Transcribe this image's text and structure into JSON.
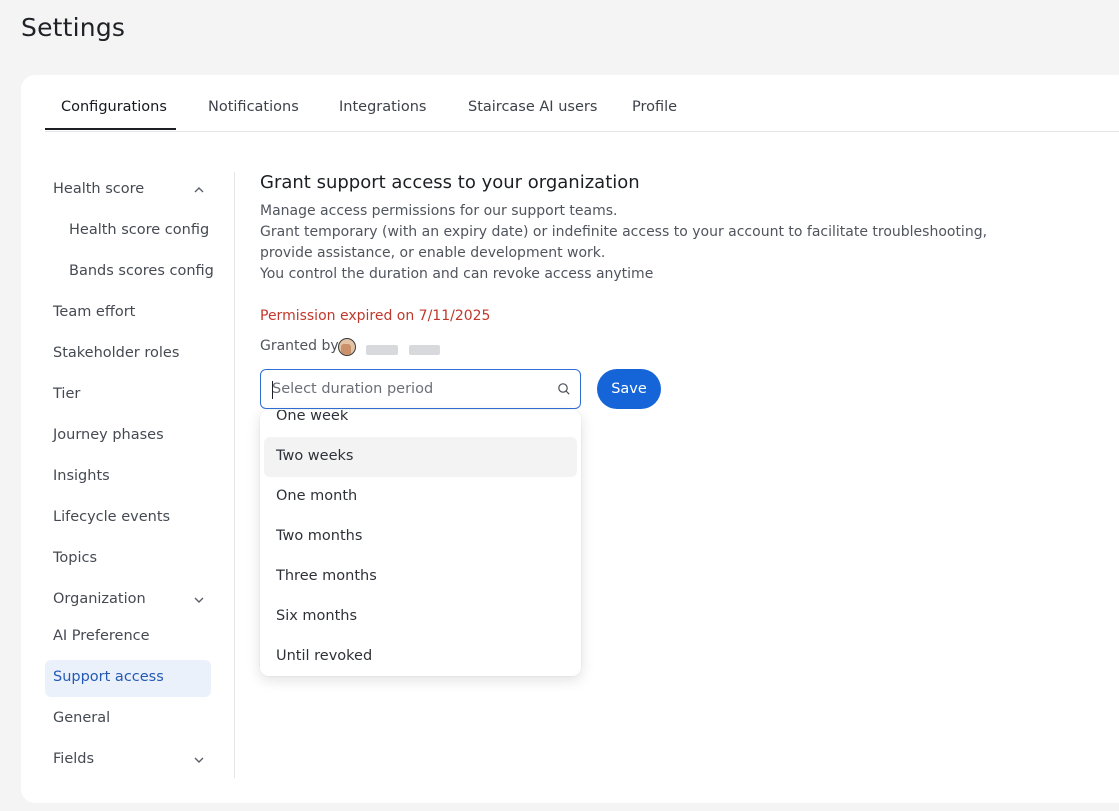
{
  "page": {
    "title": "Settings"
  },
  "tabs": [
    {
      "label": "Configurations",
      "active": true
    },
    {
      "label": "Notifications"
    },
    {
      "label": "Integrations"
    },
    {
      "label": "Staircase AI users"
    },
    {
      "label": "Profile"
    }
  ],
  "sidebar": {
    "items": [
      {
        "label": "Health score",
        "expanded": true
      },
      {
        "label": "Health score config"
      },
      {
        "label": "Bands scores config"
      },
      {
        "label": "Team effort"
      },
      {
        "label": "Stakeholder roles"
      },
      {
        "label": "Tier"
      },
      {
        "label": "Journey phases"
      },
      {
        "label": "Insights"
      },
      {
        "label": "Lifecycle events"
      },
      {
        "label": "Topics"
      },
      {
        "label": "Organization",
        "expanded": false
      },
      {
        "label": "AI Preference"
      },
      {
        "label": "Support access",
        "active": true
      },
      {
        "label": "General"
      },
      {
        "label": "Fields",
        "expanded": false
      }
    ]
  },
  "support": {
    "title": "Grant support access to your organization",
    "desc1": "Manage access permissions for our support teams.",
    "desc2": "Grant temporary (with an expiry date) or indefinite access to your account to facilitate troubleshooting, provide assistance, or enable development work.",
    "desc3": "You control the duration and can revoke access anytime",
    "expired": "Permission expired on 7/11/2025",
    "granted_by": "Granted by",
    "select_placeholder": "Select duration period",
    "save_label": "Save",
    "options": [
      "One week",
      "Two weeks",
      "One month",
      "Two months",
      "Three months",
      "Six months",
      "Until revoked"
    ],
    "hovered_option": "Two weeks"
  },
  "colors": {
    "accent": "#1565d8",
    "error": "#c0382b",
    "active_nav_bg": "#ebf1fb"
  }
}
